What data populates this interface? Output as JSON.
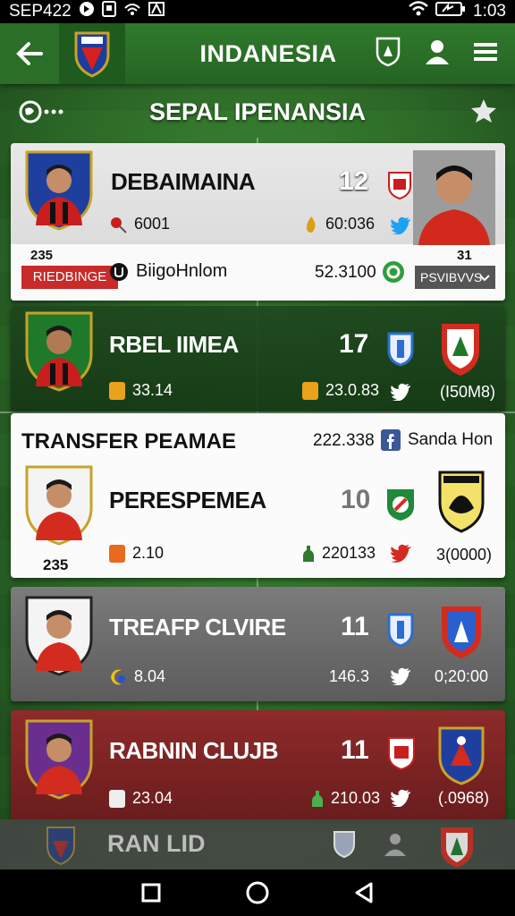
{
  "status_bar": {
    "left_text": "SEP422",
    "time": "1:03"
  },
  "app_bar": {
    "title": "INDANESIA"
  },
  "section": {
    "title": "SEPAL IPENANSIA"
  },
  "cards": [
    {
      "name": "DEBAIMAINA",
      "number": "12",
      "stat1": "6001",
      "stat2": "60:036",
      "id_under_shield": "235",
      "badge_left": "RIEDBINGE",
      "badge_right": "PSVIBVVS",
      "sponsor": "BiigoHnlom",
      "value": "52.3100",
      "right_number": "31"
    },
    {
      "name": "RBEL IIMEA",
      "number": "17",
      "stat1": "33.14",
      "stat2": "23.0.83",
      "right_value": "(I50M8)"
    },
    {
      "header_title": "TRANSFER PEAMAE",
      "header_value": "222.338",
      "header_link": "Sanda Hon",
      "name": "PERESPEMEA",
      "number": "10",
      "stat1": "2.10",
      "stat2": "220133",
      "right_value": "3(0000)",
      "id_under_shield": "235"
    },
    {
      "name": "TREAFP CLVIRE",
      "number": "11",
      "stat1": "8.04",
      "stat2": "146.3",
      "right_value": "0;20:00"
    },
    {
      "name": "RABNIN CLUJB",
      "number": "11",
      "stat1": "23.04",
      "stat2": "210.03",
      "right_value": "(.0968)"
    }
  ],
  "bottom_nav": {
    "label": "RAN LID"
  },
  "colors": {
    "accent_green": "#2f7a2c",
    "red": "#c92a2a",
    "twitter_blue": "#1da1f2"
  }
}
